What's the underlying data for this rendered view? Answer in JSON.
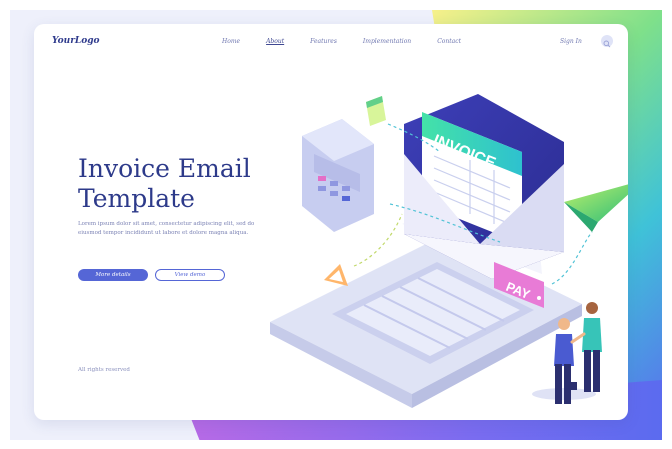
{
  "brand": {
    "logo": "YourLogo"
  },
  "nav": {
    "items": [
      {
        "label": "Home",
        "active": false
      },
      {
        "label": "About",
        "active": true
      },
      {
        "label": "Features",
        "active": false
      },
      {
        "label": "Implementation",
        "active": false
      },
      {
        "label": "Contact",
        "active": false
      }
    ],
    "sign_in": "Sign In",
    "search_icon": "search-icon"
  },
  "hero": {
    "title_line1": "Invoice Email",
    "title_line2": "Template",
    "body": "Lorem ipsum dolor sit amet, consectetur adipiscing elit, sed do eiusmod tempor incididunt ut labore et dolore magna aliqua.",
    "primary_button": "More details",
    "secondary_button": "View demo"
  },
  "illustration": {
    "envelope_label": "INVOICE",
    "pay_label": "PAY"
  },
  "footer": {
    "text": "All rights reserved"
  },
  "colors": {
    "accent": "#5566d6",
    "title": "#2d3a8a",
    "nav_text": "#6f77b0",
    "pay_tag": "#e87bd6",
    "invoice_header": "#36d6a8"
  }
}
